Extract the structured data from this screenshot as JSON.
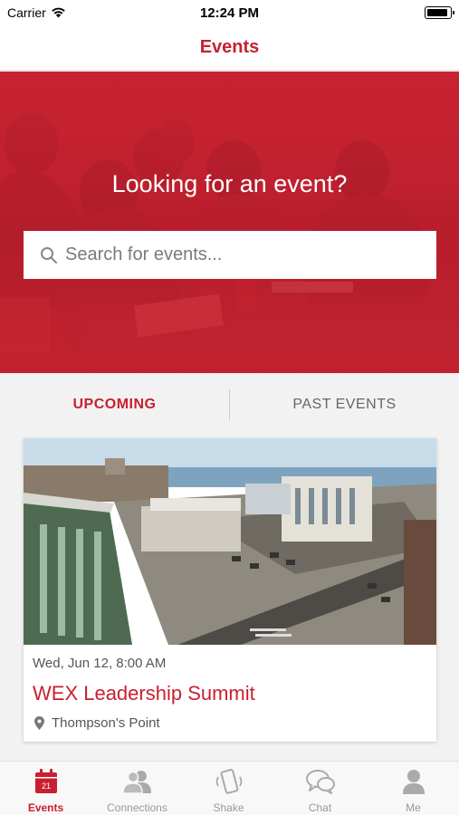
{
  "status_bar": {
    "carrier": "Carrier",
    "time": "12:24 PM"
  },
  "nav": {
    "title": "Events"
  },
  "hero": {
    "heading": "Looking for an event?",
    "search_placeholder": "Search for events..."
  },
  "tabs": [
    {
      "label": "UPCOMING",
      "active": true
    },
    {
      "label": "PAST EVENTS",
      "active": false
    }
  ],
  "events": [
    {
      "date": "Wed, Jun 12, 8:00 AM",
      "title": "WEX Leadership Summit",
      "location": "Thompson's Point"
    }
  ],
  "tab_bar": {
    "calendar_day": "21",
    "items": [
      {
        "label": "Events",
        "icon": "calendar-icon",
        "active": true
      },
      {
        "label": "Connections",
        "icon": "people-icon",
        "active": false
      },
      {
        "label": "Shake",
        "icon": "shake-phone-icon",
        "active": false
      },
      {
        "label": "Chat",
        "icon": "chat-bubbles-icon",
        "active": false
      },
      {
        "label": "Me",
        "icon": "person-icon",
        "active": false
      }
    ]
  },
  "colors": {
    "accent": "#c8202f",
    "inactive": "#999999",
    "background": "#f2f2f2"
  }
}
